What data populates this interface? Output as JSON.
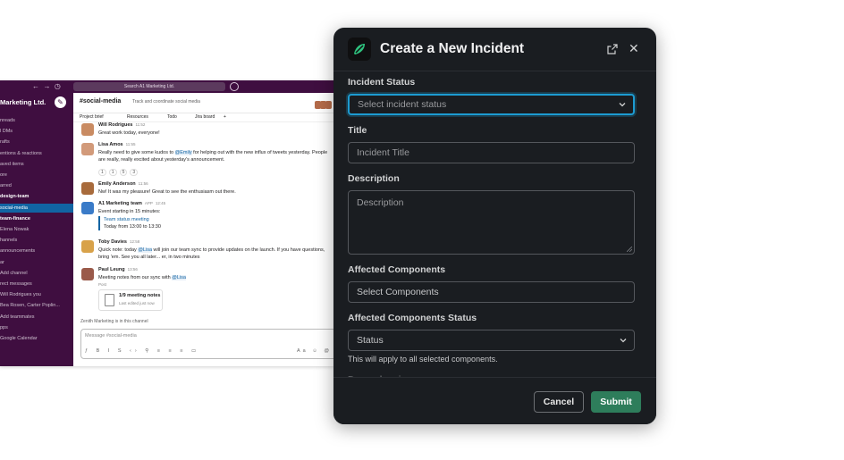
{
  "slack": {
    "search_placeholder": "Search A1 Marketing Ltd.",
    "workspace_name": "Marketing Ltd.",
    "sidebar_items": [
      {
        "label": "nreads",
        "style": "normal"
      },
      {
        "label": "l DMs",
        "style": "normal"
      },
      {
        "label": "rafts",
        "style": "normal"
      },
      {
        "label": "entions & reactions",
        "style": "normal"
      },
      {
        "label": "aved items",
        "style": "normal"
      },
      {
        "label": "ore",
        "style": "normal"
      },
      {
        "label": "arred",
        "style": "normal"
      },
      {
        "label": "design-team",
        "style": "bold"
      },
      {
        "label": "social-media",
        "style": "active"
      },
      {
        "label": "team-finance",
        "style": "bold"
      },
      {
        "label": "Elena Nowak",
        "style": "normal"
      },
      {
        "label": "hannels",
        "style": "normal"
      },
      {
        "label": "announcements",
        "style": "normal"
      },
      {
        "label": "ar",
        "style": "normal"
      },
      {
        "label": "Add channel",
        "style": "normal"
      },
      {
        "label": "rect messages",
        "style": "normal"
      },
      {
        "label": "Will Rodrigues  you",
        "style": "normal"
      },
      {
        "label": "Bea Rosen, Carter Poplin...",
        "style": "normal"
      },
      {
        "label": "Add teammates",
        "style": "normal"
      },
      {
        "label": "pps",
        "style": "normal"
      },
      {
        "label": "Google Calendar",
        "style": "normal"
      }
    ],
    "channel_name": "#social-media",
    "channel_topic": "Track and coordinate social media",
    "bookmarks": [
      "Project brief",
      "Resources",
      "Todo",
      "Jira board",
      "+"
    ],
    "messages": [
      {
        "name": "Will Rodrigues",
        "time": "11:52",
        "text": "Great work today, everyone!"
      },
      {
        "name": "Lisa Amos",
        "time": "11:55",
        "text_before": "Really need to give some kudos to ",
        "mention": "@Emily",
        "text_after": " for helping out with the new influx of tweets yesterday. People are really, really excited about yesterday's announcement."
      },
      {
        "name": "Emily Anderson",
        "time": "11:56",
        "text": "Nw! It was my pleasure! Great to see the enthusiasm out there."
      },
      {
        "name": "A1 Marketing team",
        "tag": "APP",
        "time": "12:45",
        "text": "Event starting in 15 minutes:",
        "event_title": "Team status meeting",
        "event_time": "Today from 13:00 to 13:30"
      },
      {
        "name": "Toby Davies",
        "time": "12:58",
        "text_before": "Quick note: today ",
        "mention": "@Lisa",
        "text_after": " will join our team sync to provide updates on the launch. If you have questions, bring 'em. See you all later... er, in two minutes"
      },
      {
        "name": "Paul Leung",
        "time": "13:56",
        "text_before": "Meeting notes from our sync with ",
        "mention": "@Lisa",
        "text_after": "",
        "post_label": "Post",
        "file_title": "1/9 meeting notes",
        "file_sub": "Last edited just now"
      }
    ],
    "reactions": [
      "1",
      "1",
      "5",
      "3"
    ],
    "typing": "Zenith Marketing is in this channel",
    "composer_placeholder": "Message #social-media"
  },
  "modal": {
    "title": "Create a New Incident",
    "fields": {
      "incident_status": {
        "label": "Incident Status",
        "placeholder": "Select incident status"
      },
      "title": {
        "label": "Title",
        "placeholder": "Incident Title"
      },
      "description": {
        "label": "Description",
        "placeholder": "Description"
      },
      "affected_components": {
        "label": "Affected Components",
        "placeholder": "Select Components"
      },
      "affected_components_status": {
        "label": "Affected Components Status",
        "placeholder": "Status",
        "hint": "This will apply to all selected components."
      }
    },
    "cut_off_label": "Dependencies",
    "cancel_label": "Cancel",
    "submit_label": "Submit",
    "colors": {
      "background": "#1a1d21",
      "submit": "#2e7d5b",
      "focus": "#1d9bd1"
    }
  }
}
